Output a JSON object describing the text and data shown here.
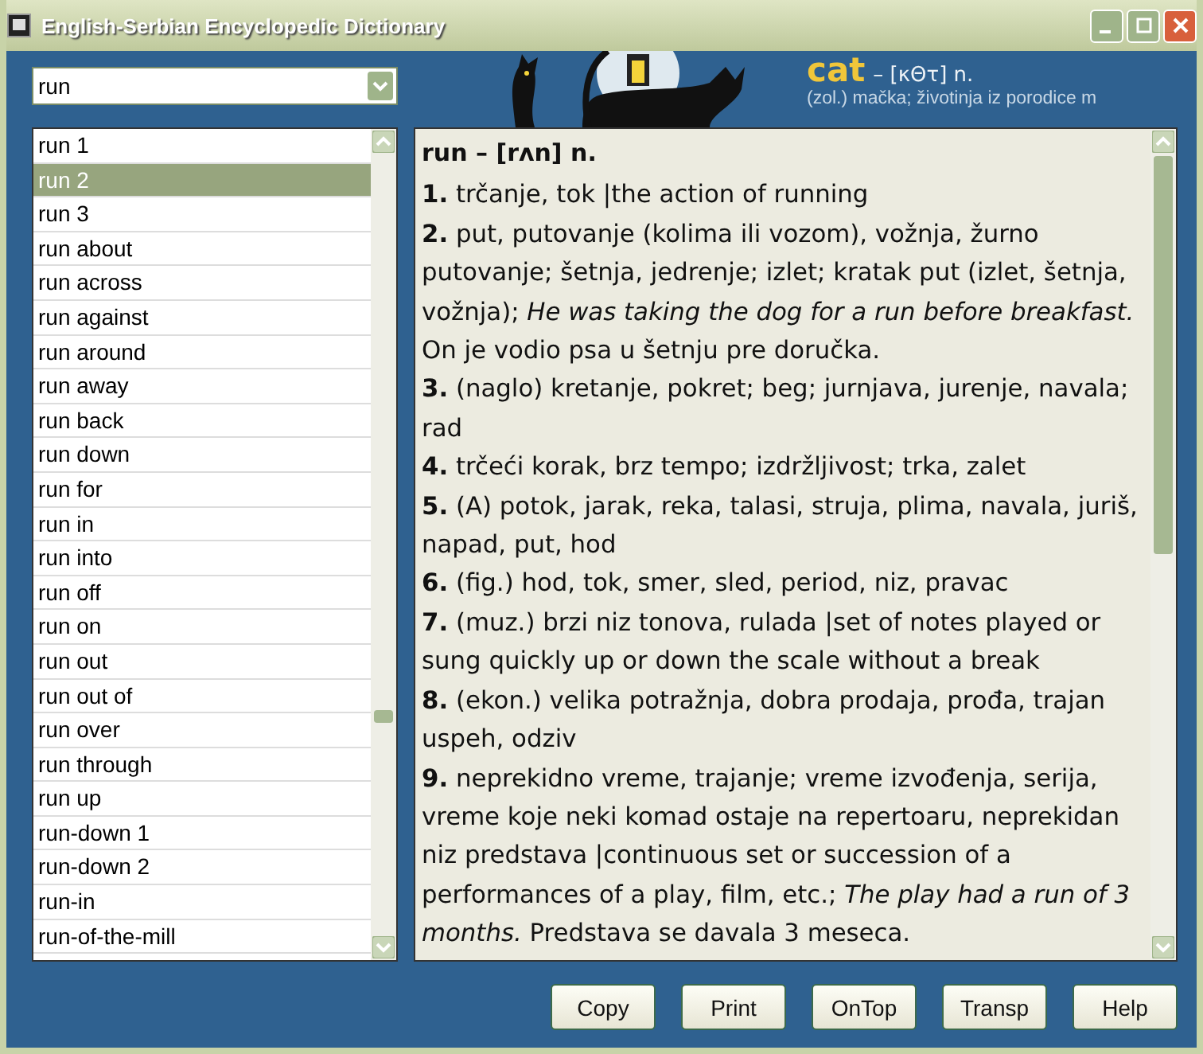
{
  "window": {
    "title": "English-Serbian Encyclopedic Dictionary"
  },
  "search": {
    "value": "run"
  },
  "banner": {
    "headword": "cat",
    "pronunciation": "– [κΘτ] n.",
    "definition": "(zol.) mačka; životinja iz porodice m"
  },
  "word_list": [
    {
      "label": "run 1",
      "selected": false
    },
    {
      "label": "run 2",
      "selected": true
    },
    {
      "label": "run 3",
      "selected": false
    },
    {
      "label": "run about",
      "selected": false
    },
    {
      "label": "run across",
      "selected": false
    },
    {
      "label": "run against",
      "selected": false
    },
    {
      "label": "run around",
      "selected": false
    },
    {
      "label": "run away",
      "selected": false
    },
    {
      "label": "run back",
      "selected": false
    },
    {
      "label": "run down",
      "selected": false
    },
    {
      "label": "run for",
      "selected": false
    },
    {
      "label": "run in",
      "selected": false
    },
    {
      "label": "run into",
      "selected": false
    },
    {
      "label": "run off",
      "selected": false
    },
    {
      "label": "run on",
      "selected": false
    },
    {
      "label": "run out",
      "selected": false
    },
    {
      "label": "run out of",
      "selected": false
    },
    {
      "label": "run over",
      "selected": false
    },
    {
      "label": "run through",
      "selected": false
    },
    {
      "label": "run up",
      "selected": false
    },
    {
      "label": "run-down 1",
      "selected": false
    },
    {
      "label": "run-down 2",
      "selected": false
    },
    {
      "label": "run-in",
      "selected": false
    },
    {
      "label": "run-of-the-mill",
      "selected": false
    }
  ],
  "entry": {
    "headword": "run",
    "pronunciation": "– [rʌn] n.",
    "senses": [
      {
        "number": "1.",
        "text": "trčanje, tok |the action of running"
      },
      {
        "number": "2.",
        "text": "put, putovanje (kolima ili vozom), vožnja, žurno putovanje; šetnja, jedrenje; izlet; kratak put (izlet, šetnja, vožnja); *He was taking the dog for a run before breakfast.* On je vodio psa u šetnju pre doručka."
      },
      {
        "number": "3.",
        "text": "(naglo) kretanje, pokret; beg; jurnjava, jurenje, navala; rad"
      },
      {
        "number": "4.",
        "text": "trčeći korak, brz tempo; izdržljivost; trka, zalet"
      },
      {
        "number": "5.",
        "text": "(A) potok, jarak, reka, talasi, struja, plima, navala, juriš, napad, put, hod"
      },
      {
        "number": "6.",
        "text": "(fig.) hod, tok, smer, sled, period, niz, pravac"
      },
      {
        "number": "7.",
        "text": "(muz.) brzi niz tonova, rulada |set of notes played or sung quickly up or down the scale without a break"
      },
      {
        "number": "8.",
        "text": "(ekon.) velika potražnja, dobra prodaja, prođa, trajan uspeh, odziv"
      },
      {
        "number": "9.",
        "text": "neprekidno vreme, trajanje; vreme izvođenja, serija, vreme koje neki komad ostaje na repertoaru, neprekidan niz predstava |continuous set or succession of a performances of a play, film, etc.; *The play had a run of 3 months.* Predstava se davala 3 meseca."
      }
    ]
  },
  "buttons": [
    "Copy",
    "Print",
    "OnTop",
    "Transp",
    "Help"
  ]
}
